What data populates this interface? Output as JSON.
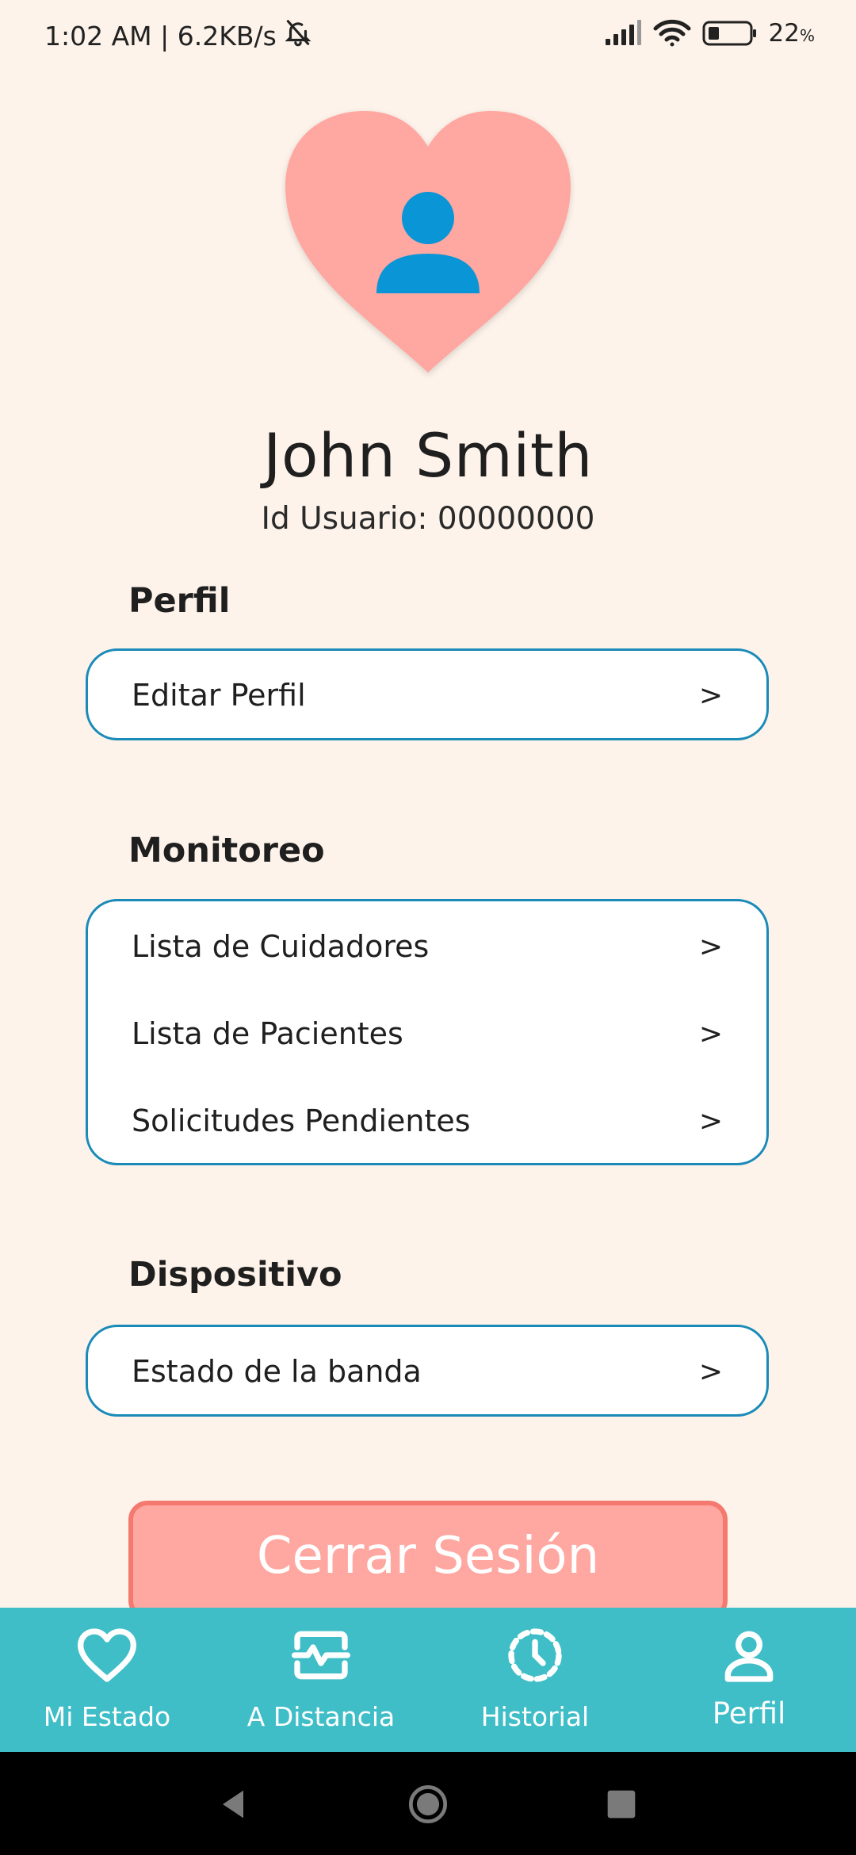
{
  "status_bar": {
    "time_speed": "1:02 AM | 6.2KB/s",
    "battery_percent": "22",
    "battery_unit": "%",
    "icons": [
      "bell-off-icon",
      "signal-icon",
      "wifi-icon",
      "battery-icon"
    ]
  },
  "profile": {
    "name": "John Smith",
    "user_id": "Id Usuario: 00000000"
  },
  "sections": {
    "perfil": {
      "title": "Perfil",
      "items": [
        {
          "label": "Editar Perfil",
          "chevron": ">"
        }
      ]
    },
    "monitoreo": {
      "title": "Monitoreo",
      "items": [
        {
          "label": "Lista de Cuidadores",
          "chevron": ">"
        },
        {
          "label": "Lista de Pacientes",
          "chevron": ">"
        },
        {
          "label": "Solicitudes Pendientes",
          "chevron": ">"
        }
      ]
    },
    "dispositivo": {
      "title": "Dispositivo",
      "items": [
        {
          "label": "Estado de la banda",
          "chevron": ">"
        }
      ]
    }
  },
  "logout_label": "Cerrar Sesión",
  "bottom_nav": {
    "items": [
      {
        "label": "Mi Estado",
        "icon": "heart-icon"
      },
      {
        "label": "A Distancia",
        "icon": "monitor-pulse-icon"
      },
      {
        "label": "Historial",
        "icon": "clock-icon"
      },
      {
        "label": "Perfil",
        "icon": "user-icon"
      }
    ],
    "active": "Perfil"
  },
  "colors": {
    "background": "#FDF3EA",
    "heart": "#FFA7A0",
    "avatar_person": "#0A96D6",
    "card_border": "#1A8BB8",
    "logout_fill": "#FFA7A0",
    "logout_border": "#F47A70",
    "nav_bg": "#3FBEC8"
  }
}
